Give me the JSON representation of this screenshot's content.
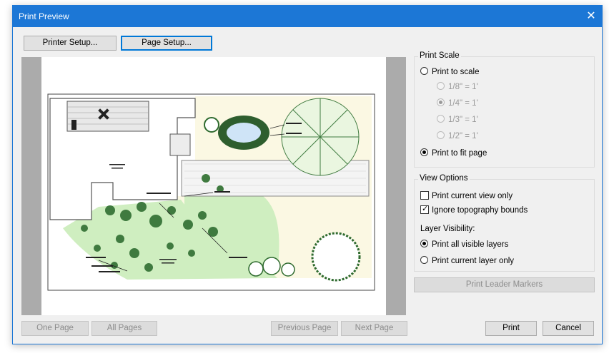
{
  "window": {
    "title": "Print Preview",
    "close_glyph": "✕"
  },
  "toolbar": {
    "printer_setup_label": "Printer Setup...",
    "page_setup_label": "Page Setup..."
  },
  "print_scale": {
    "group_label": "Print Scale",
    "print_to_scale_label": "Print to scale",
    "scales": [
      "1/8\" = 1'",
      "1/4\" = 1'",
      "1/3\" = 1'",
      "1/2\" = 1'"
    ],
    "selected_scale": "1/4\" = 1'",
    "print_to_fit_label": "Print to fit page",
    "mode_selected": "Print to fit page"
  },
  "view_options": {
    "group_label": "View Options",
    "current_view_only_label": "Print current view only",
    "current_view_only_checked": false,
    "ignore_topography_label": "Ignore topography bounds",
    "ignore_topography_checked": true,
    "layer_visibility_label": "Layer Visibility:",
    "all_layers_label": "Print all visible layers",
    "current_layer_label": "Print current layer only",
    "layer_selected": "Print all visible layers"
  },
  "leader_markers_label": "Print Leader Markers",
  "pager": {
    "one_page_label": "One Page",
    "all_pages_label": "All Pages",
    "previous_label": "Previous Page",
    "next_label": "Next Page"
  },
  "actions": {
    "print_label": "Print",
    "cancel_label": "Cancel"
  },
  "icons": {
    "close": "close-icon"
  },
  "colors": {
    "titlebar": "#1c77d6",
    "lawn": "#cfeec0",
    "patio": "#f5f2dc",
    "foliage": "#2f6b2f"
  }
}
